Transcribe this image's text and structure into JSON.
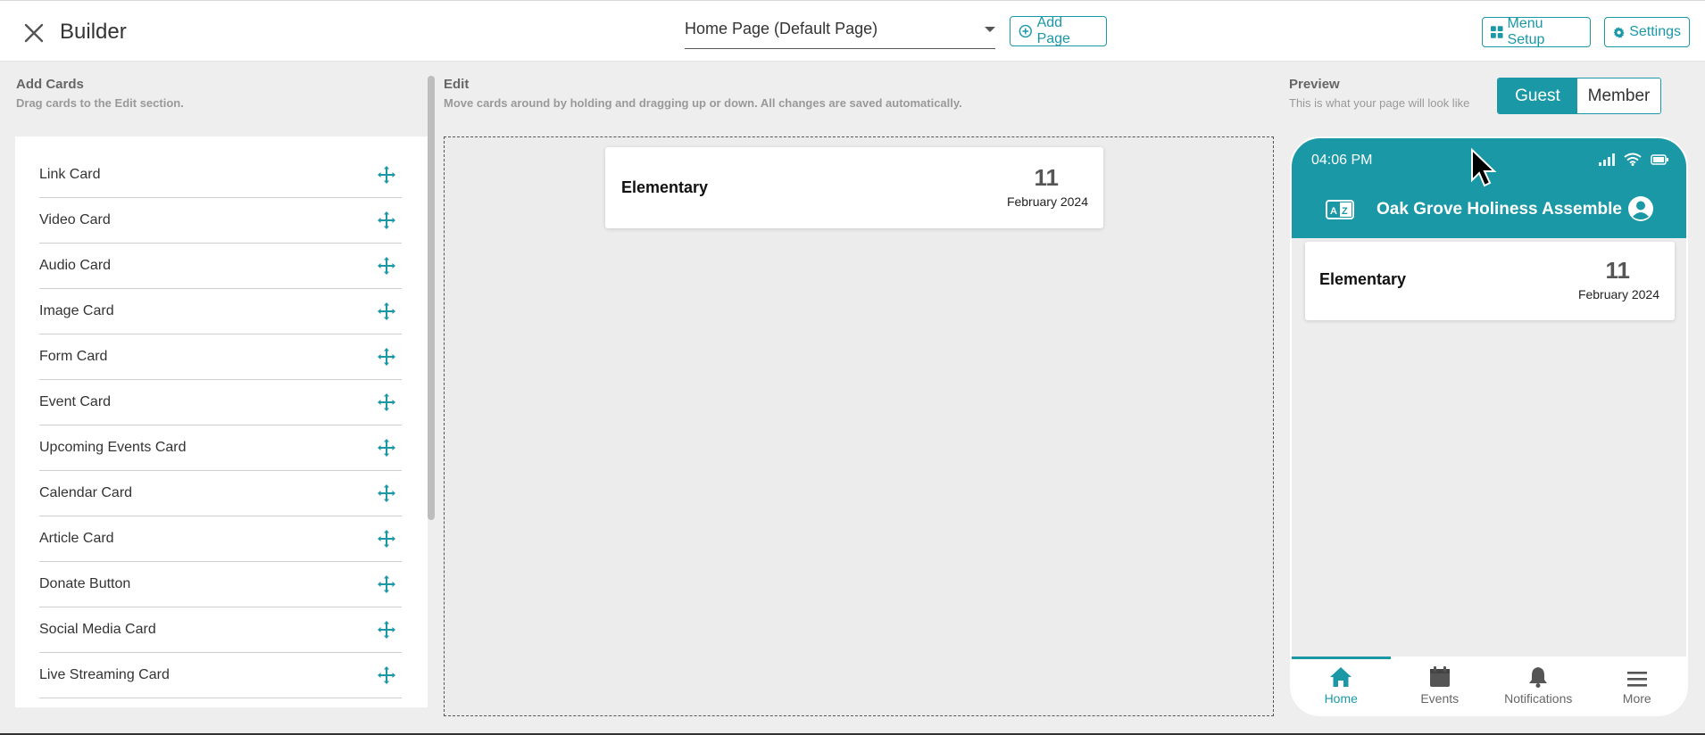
{
  "header": {
    "title": "Builder",
    "page_select": "Home Page (Default Page)",
    "add_page": "Add Page",
    "menu_setup": "Menu Setup",
    "settings": "Settings"
  },
  "add_cards": {
    "title": "Add Cards",
    "subtitle": "Drag cards to the Edit section.",
    "items": [
      {
        "label": "Link Card"
      },
      {
        "label": "Video Card"
      },
      {
        "label": "Audio Card"
      },
      {
        "label": "Image Card"
      },
      {
        "label": "Form Card"
      },
      {
        "label": "Event Card"
      },
      {
        "label": "Upcoming Events Card"
      },
      {
        "label": "Calendar Card"
      },
      {
        "label": "Article Card"
      },
      {
        "label": "Donate Button"
      },
      {
        "label": "Social Media Card"
      },
      {
        "label": "Live Streaming Card"
      }
    ]
  },
  "edit": {
    "title": "Edit",
    "subtitle": "Move cards around by holding and dragging up or down. All changes are saved automatically.",
    "card": {
      "name": "Elementary",
      "day": "11",
      "month": "February 2024"
    }
  },
  "preview": {
    "title": "Preview",
    "subtitle": "This is what your page will look like",
    "toggle": {
      "guest": "Guest",
      "member": "Member",
      "selected": "Guest"
    },
    "phone": {
      "time": "04:06 PM",
      "app_title": "Oak Grove Holiness Assemble",
      "card": {
        "name": "Elementary",
        "day": "11",
        "month": "February 2024"
      },
      "nav": [
        {
          "label": "Home",
          "icon": "home-icon",
          "active": true
        },
        {
          "label": "Events",
          "icon": "calendar-icon"
        },
        {
          "label": "Notifications",
          "icon": "bell-icon"
        },
        {
          "label": "More",
          "icon": "menu-icon"
        }
      ]
    }
  },
  "colors": {
    "accent": "#1a98a6",
    "background": "#eeeeee"
  }
}
